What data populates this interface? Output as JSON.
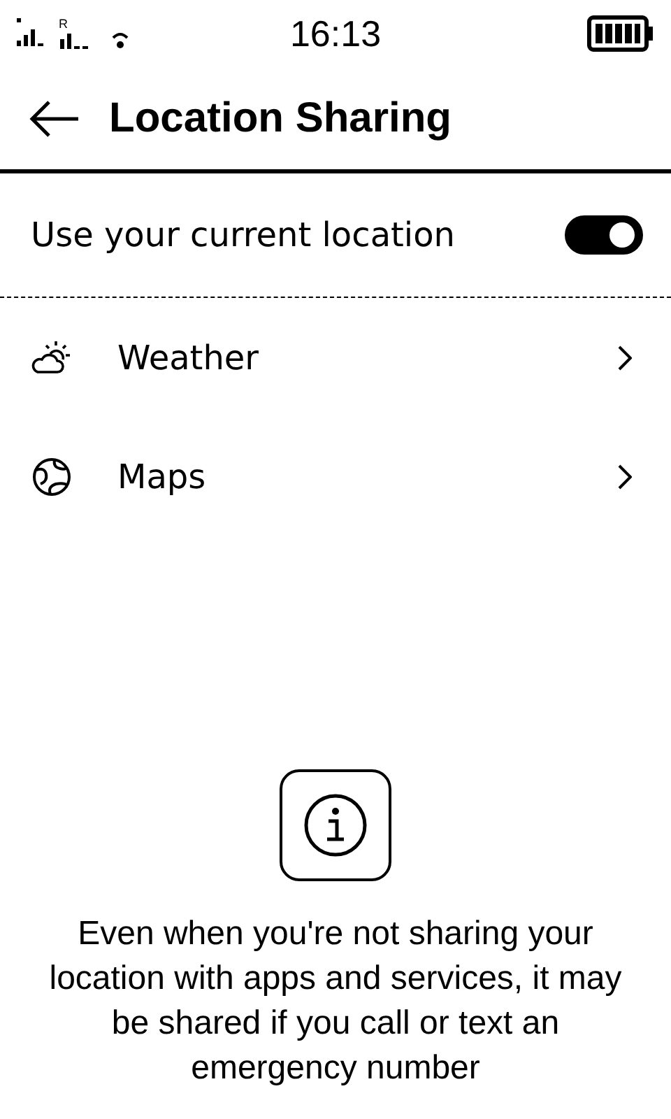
{
  "status_bar": {
    "roaming_label": "R",
    "time": "16:13"
  },
  "header": {
    "title": "Location Sharing"
  },
  "settings": [
    {
      "kind": "toggle",
      "label": "Use your current location",
      "on": true
    },
    {
      "kind": "link",
      "label": "Weather"
    },
    {
      "kind": "link",
      "label": "Maps"
    }
  ],
  "info": {
    "text": "Even when you're not sharing your location with apps and services, it may be shared if you call or text an emergency number"
  }
}
